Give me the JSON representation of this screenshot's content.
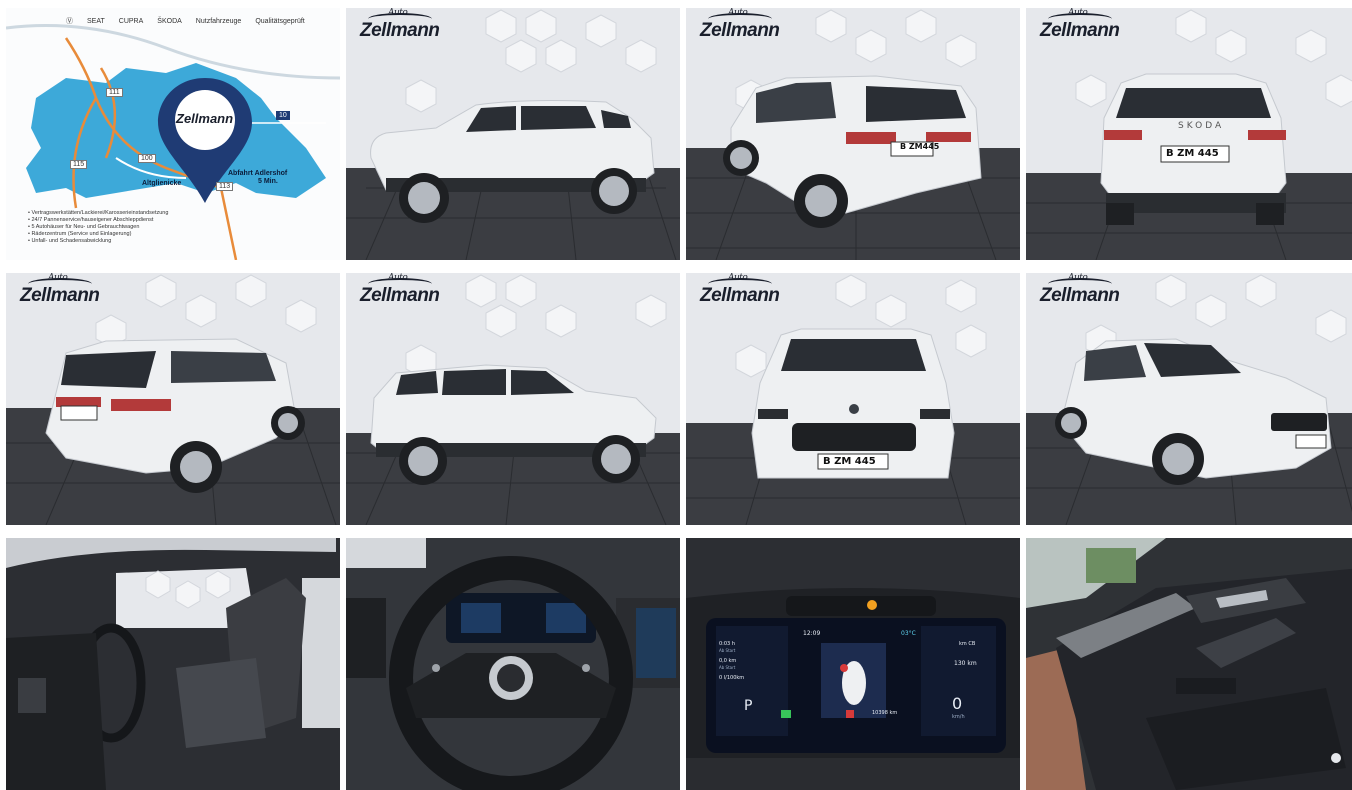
{
  "brand": {
    "logo_script": "Auto",
    "logo_main": "Zellmann"
  },
  "map": {
    "brands": [
      "SEAT",
      "CUPRA",
      "ŠKODA",
      "Nutzfahrzeuge",
      "Qualitätsgeprüft"
    ],
    "routes": [
      "111",
      "100",
      "10",
      "115",
      "113"
    ],
    "labels": {
      "altglienicke": "Altglienicke",
      "exit": "Abfahrt Adlershof",
      "exit_time": "5 Min."
    },
    "bullets": [
      "• Vertragswerkstätten/Lackierei/Karosserieinstandsetzung",
      "• 24/7 Pannenservice/hauseigener Abschleppdienst",
      "• 5 Autohäuser für Neu- und Gebrauchtwagen",
      "• Räderzentrum (Service und Einlagerung)",
      "• Unfall- und Schadensabwicklung"
    ]
  },
  "plates": {
    "side": "B ZM445",
    "rear": "B ZM 445",
    "front": "B ZM 445"
  },
  "rear_badge": "SKODA",
  "dashboard": {
    "time": "12:09",
    "temp": "03°C",
    "left_top": "0:03 h",
    "left_top_sub": "Ab Start",
    "left_mid": "0,0 km",
    "left_mid_sub": "Ab Start",
    "left_cons": "0 l/100km",
    "right_top": "km CB",
    "right_val": "130 km",
    "odometer": "10398 km",
    "gear": "P",
    "speed": "0",
    "speed_unit": "km/h"
  },
  "colors": {
    "map_blue": "#3da9d9",
    "pin": "#1f3b74",
    "road": "#e88b3a",
    "car_white": "#eef0f2",
    "floor": "#3b3d42"
  }
}
